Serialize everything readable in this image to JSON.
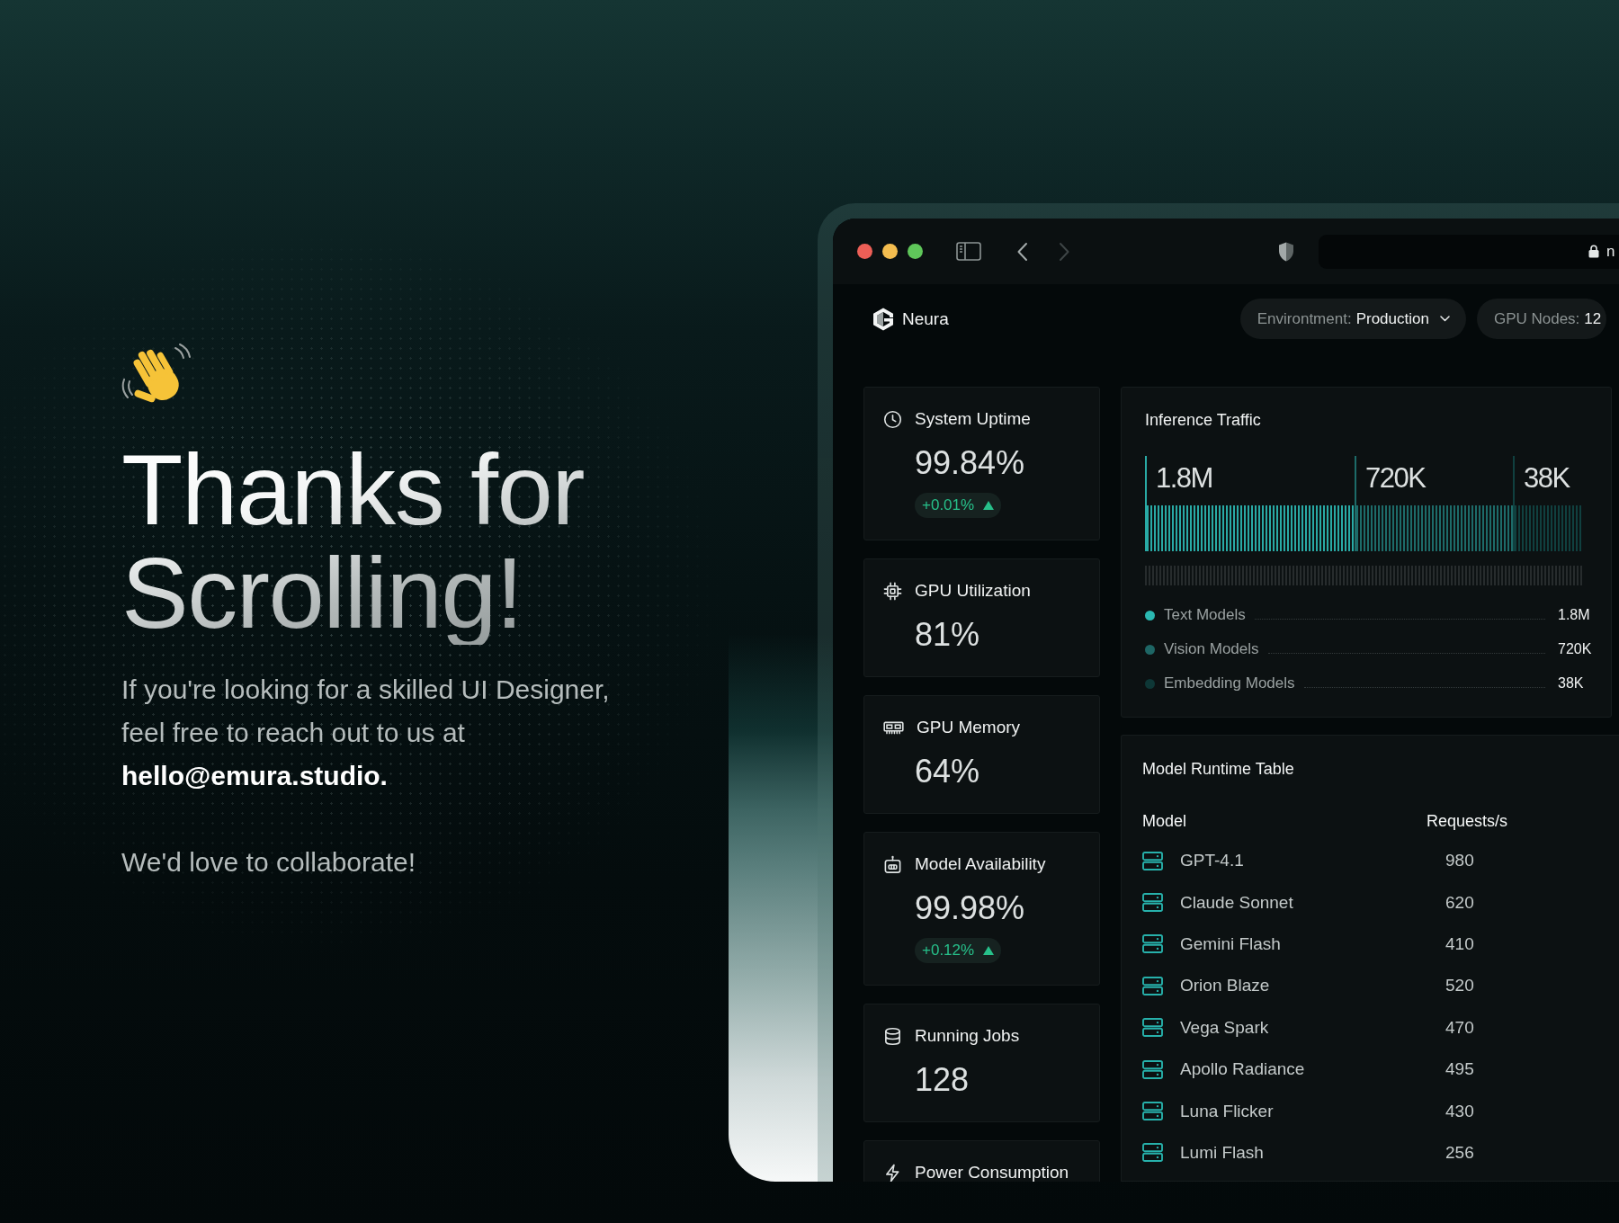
{
  "hero": {
    "title": "Thanks for Scrolling!",
    "message": "If you're looking for a skilled UI Designer, feel free to reach out to us at **hello@emura.studio.**",
    "closing": "We'd love to collaborate!"
  },
  "browser": {
    "back": {
      "disabled": false
    },
    "forward": {
      "disabled": true
    },
    "address": "n"
  },
  "app": {
    "brand": "Neura",
    "filters": [
      {
        "kind": "dropdown",
        "label": "Environtment:",
        "value": "Production"
      },
      {
        "kind": "readout",
        "label": "GPU Nodes:",
        "value": "12"
      }
    ]
  },
  "stats": [
    {
      "title": "System Uptime",
      "value": "99.84%",
      "delta": {
        "text": "+0.01%",
        "rising": true
      }
    },
    {
      "title": "GPU Utilization",
      "value": "81%"
    },
    {
      "title": "GPU Memory",
      "value": "64%"
    },
    {
      "title": "Model Availability",
      "value": "99.98%",
      "delta": {
        "text": "+0.12%",
        "rising": true
      }
    },
    {
      "title": "Running Jobs",
      "value": "128"
    },
    {
      "title": "Power Consumption"
    }
  ],
  "inference_traffic": {
    "title": "Inference Traffic",
    "segments": [
      {
        "value": "1.8M",
        "color": "#29aaa5"
      },
      {
        "value": "720K",
        "color": "#1d6b69"
      },
      {
        "value": "38K",
        "color": "#10403f"
      }
    ],
    "legend": [
      {
        "name": "Text Models",
        "value": "1.8M",
        "color": "#2bb9b2"
      },
      {
        "name": "Vision Models",
        "value": "720K",
        "color": "#1e6665"
      },
      {
        "name": "Embedding Models",
        "value": "38K",
        "color": "#0e3736"
      }
    ]
  },
  "model_table": {
    "title": "Model Runtime Table",
    "columns": [
      "Model",
      "Requests/s"
    ],
    "rows": [
      {
        "model": "GPT-4.1",
        "requests": "980"
      },
      {
        "model": "Claude Sonnet",
        "requests": "620"
      },
      {
        "model": "Gemini Flash",
        "requests": "410"
      },
      {
        "model": "Orion Blaze",
        "requests": "520"
      },
      {
        "model": "Vega Spark",
        "requests": "470"
      },
      {
        "model": "Apollo Radiance",
        "requests": "495"
      },
      {
        "model": "Luna Flicker",
        "requests": "430"
      },
      {
        "model": "Lumi Flash",
        "requests": "256"
      }
    ]
  }
}
